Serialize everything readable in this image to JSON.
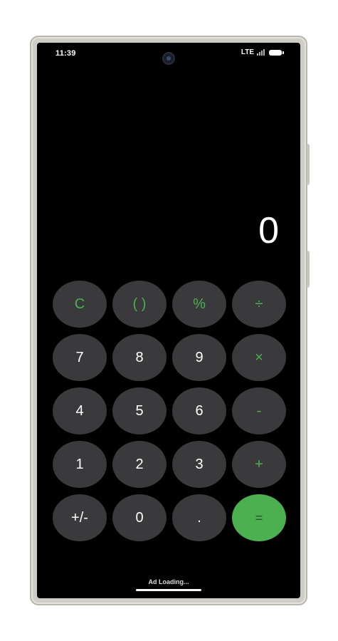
{
  "status_bar": {
    "time": "11:39",
    "network": "LTE",
    "icons": [
      "signal-icon",
      "battery-icon"
    ]
  },
  "display": {
    "value": "0"
  },
  "keypad": {
    "clear": "C",
    "parens": "( )",
    "percent": "%",
    "divide": "÷",
    "seven": "7",
    "eight": "8",
    "nine": "9",
    "multiply": "×",
    "four": "4",
    "five": "5",
    "six": "6",
    "minus": "-",
    "one": "1",
    "two": "2",
    "three": "3",
    "plus": "+",
    "negate": "+/-",
    "zero": "0",
    "decimal": ".",
    "equals": "="
  },
  "footer": {
    "ad_text": "Ad Loading..."
  },
  "colors": {
    "accent": "#4cb050",
    "key_background": "#3a3a3c",
    "screen_background": "#000000"
  }
}
